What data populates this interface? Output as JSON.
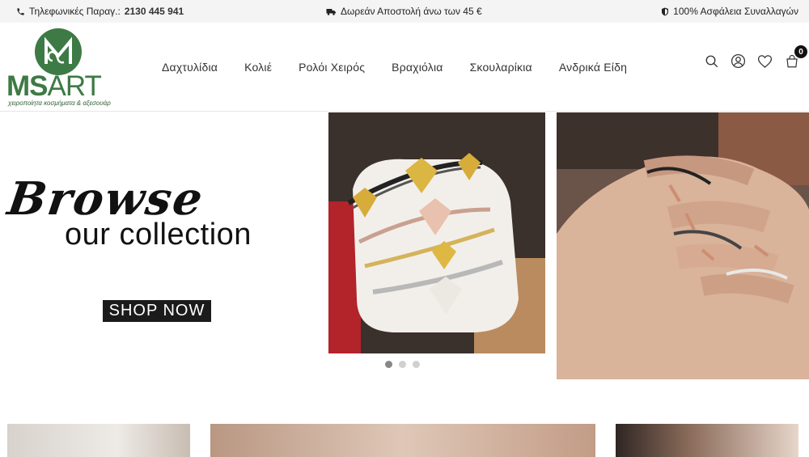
{
  "topbar": {
    "phone_label": "Τηλεφωνικές Παραγ.:",
    "phone_number": "2130 445 941",
    "shipping": "Δωρεάν Αποστολή άνω των 45 €",
    "security": "100% Ασφάλεια Συναλλαγών"
  },
  "logo": {
    "brand_ms": "MS",
    "brand_art": "ART",
    "tagline": "χειροποίητα κοσμήματα & αξεσουάρ"
  },
  "nav": {
    "items": [
      "Δαχτυλίδια",
      "Κολιέ",
      "Ρολόι Χειρός",
      "Βραχιόλια",
      "Σκουλαρίκια",
      "Ανδρικά Είδη"
    ]
  },
  "header_icons": [
    "search-icon",
    "user-icon",
    "heart-icon",
    "cart-icon"
  ],
  "cart": {
    "count": "0"
  },
  "hero": {
    "script_text": "Browse",
    "subtitle": "our collection",
    "cta": "SHOP NOW",
    "slides_total": 3,
    "active_slide": 1
  },
  "colors": {
    "brand_green": "#3e7a45",
    "topbar_bg": "#f4f4f4",
    "cta_bg": "#1b1b1b"
  }
}
